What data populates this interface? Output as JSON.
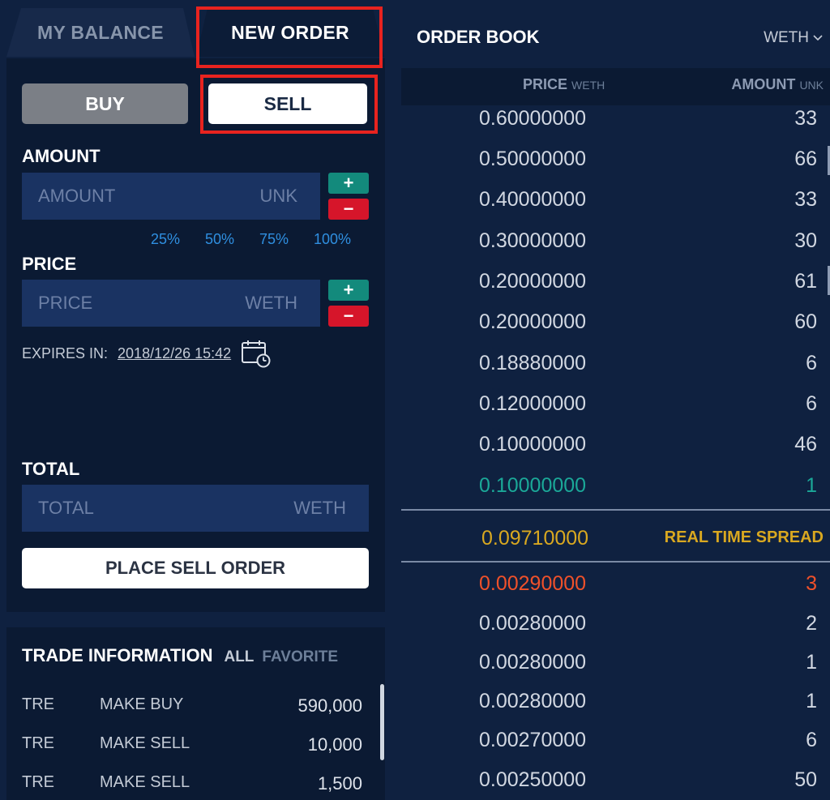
{
  "tabs": {
    "my_balance": "MY BALANCE",
    "new_order": "NEW ORDER"
  },
  "order_form": {
    "buy_label": "BUY",
    "sell_label": "SELL",
    "amount_label": "AMOUNT",
    "amount_placeholder": "AMOUNT",
    "amount_unit": "UNK",
    "percent_options": [
      "25%",
      "50%",
      "75%",
      "100%"
    ],
    "price_label": "PRICE",
    "price_placeholder": "PRICE",
    "price_unit": "WETH",
    "plus_label": "+",
    "minus_label": "−",
    "expires_label": "EXPIRES IN:",
    "expires_value": "2018/12/26 15:42",
    "total_label": "TOTAL",
    "total_placeholder": "TOTAL",
    "total_unit": "WETH",
    "place_order_label": "PLACE SELL ORDER"
  },
  "trade_info": {
    "title": "TRADE INFORMATION",
    "filter_all": "ALL",
    "filter_favorite": "FAVORITE",
    "rows": [
      {
        "symbol": "TRE",
        "type": "MAKE BUY",
        "amount": "590,000"
      },
      {
        "symbol": "TRE",
        "type": "MAKE SELL",
        "amount": "10,000"
      },
      {
        "symbol": "TRE",
        "type": "MAKE SELL",
        "amount": "1,500"
      }
    ]
  },
  "order_book": {
    "title": "ORDER BOOK",
    "market": "WETH",
    "price_header": "PRICE",
    "price_unit": "WETH",
    "amount_header": "AMOUNT",
    "amount_unit": "UNK",
    "asks": [
      {
        "price": "0.60000000",
        "amount": "33"
      },
      {
        "price": "0.50000000",
        "amount": "66"
      },
      {
        "price": "0.40000000",
        "amount": "33"
      },
      {
        "price": "0.30000000",
        "amount": "30"
      },
      {
        "price": "0.20000000",
        "amount": "61"
      },
      {
        "price": "0.20000000",
        "amount": "60"
      },
      {
        "price": "0.18880000",
        "amount": "6"
      },
      {
        "price": "0.12000000",
        "amount": "6"
      },
      {
        "price": "0.10000000",
        "amount": "46"
      },
      {
        "price": "0.10000000",
        "amount": "1"
      }
    ],
    "spread_value": "0.09710000",
    "spread_label": "REAL TIME SPREAD",
    "bids": [
      {
        "price": "0.00290000",
        "amount": "3"
      },
      {
        "price": "0.00280000",
        "amount": "2"
      },
      {
        "price": "0.00280000",
        "amount": "1"
      },
      {
        "price": "0.00280000",
        "amount": "1"
      },
      {
        "price": "0.00270000",
        "amount": "6"
      },
      {
        "price": "0.00250000",
        "amount": "50"
      }
    ]
  },
  "colors": {
    "highlight_box": "#e8231f",
    "ask_latest": "#1ba898",
    "bid_latest": "#f0512a",
    "spread": "#d9a820",
    "percent_link": "#2f8fe0"
  }
}
